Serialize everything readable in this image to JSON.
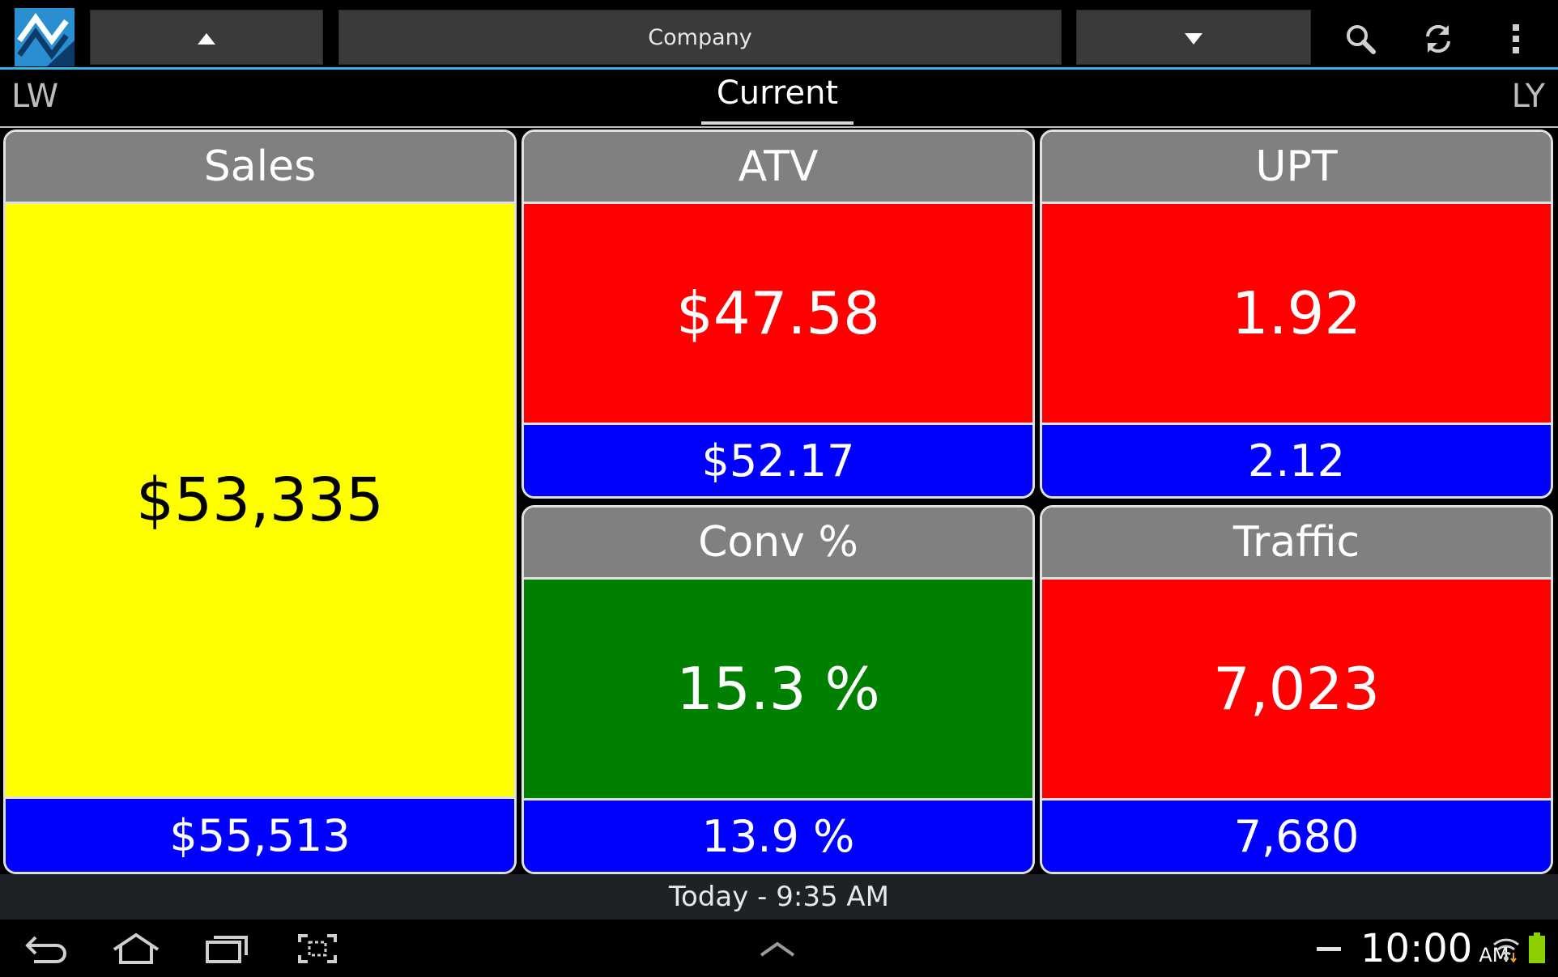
{
  "actionbar": {
    "logo_icon": "app-logo-icon",
    "up_button_icon": "caret-up-icon",
    "company_label": "Company",
    "down_button_icon": "caret-down-icon",
    "search_icon": "search-icon",
    "refresh_icon": "refresh-icon",
    "overflow_icon": "more-vert-icon",
    "accent_color": "#33b5e5"
  },
  "tabs": {
    "left": "LW",
    "current": "Current",
    "right": "LY"
  },
  "tiles": {
    "sales": {
      "title": "Sales",
      "value": "$53,335",
      "compare": "$55,513",
      "status_color": "#ffff00"
    },
    "atv": {
      "title": "ATV",
      "value": "$47.58",
      "compare": "$52.17",
      "status_color": "#ff0000"
    },
    "upt": {
      "title": "UPT",
      "value": "1.92",
      "compare": "2.12",
      "status_color": "#ff0000"
    },
    "conv": {
      "title": "Conv %",
      "value": "15.3 %",
      "compare": "13.9 %",
      "status_color": "#008000"
    },
    "traffic": {
      "title": "Traffic",
      "value": "7,023",
      "compare": "7,680",
      "status_color": "#ff0000"
    }
  },
  "status": {
    "updated": "Today - 9:35 AM"
  },
  "system": {
    "time": "10:00",
    "ampm": "AM"
  }
}
